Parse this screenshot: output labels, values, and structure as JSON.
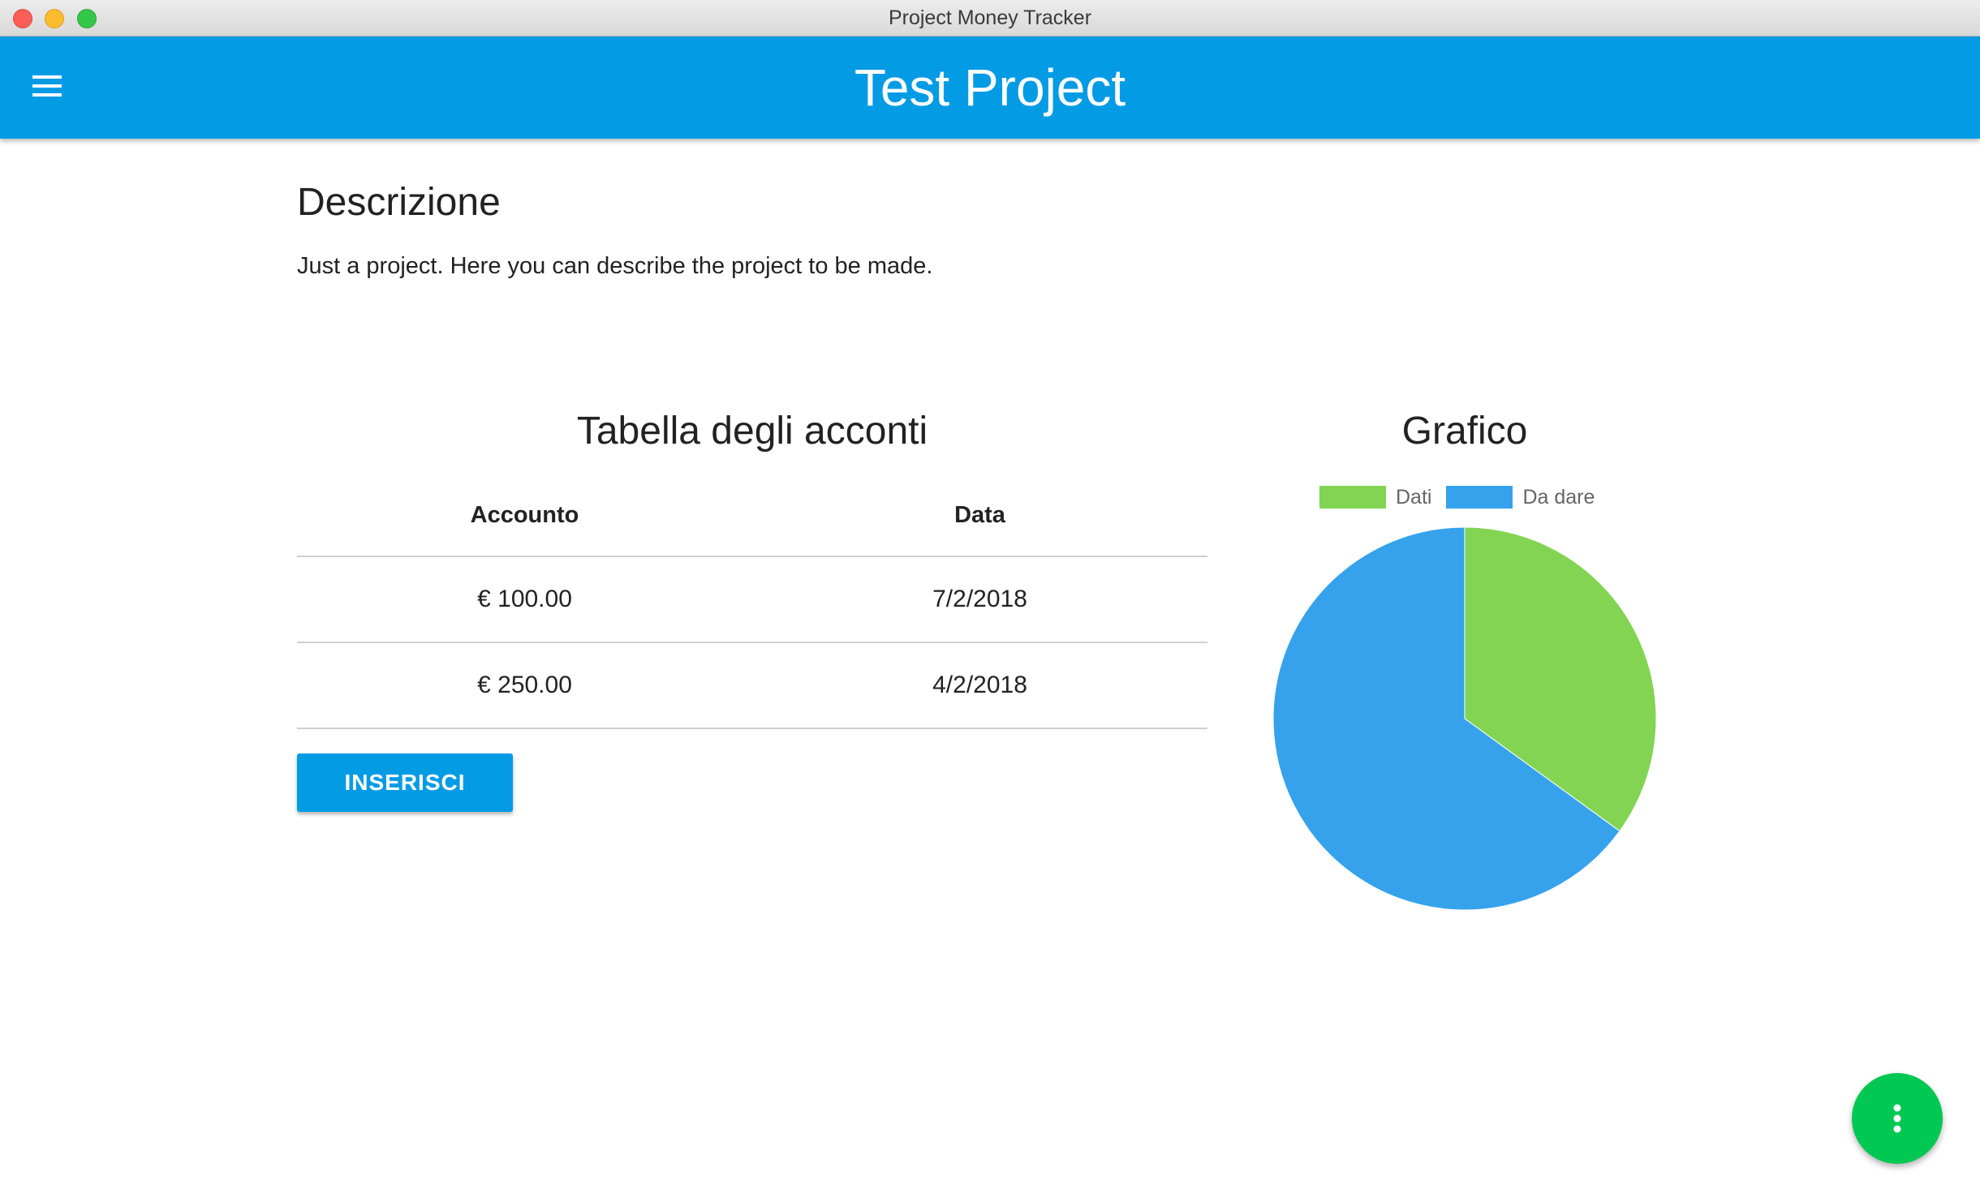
{
  "window": {
    "title": "Project Money Tracker"
  },
  "appbar": {
    "title": "Test Project",
    "menu_icon": "hamburger-menu-icon",
    "background_color": "#049be5"
  },
  "description": {
    "heading": "Descrizione",
    "text": "Just a project. Here you can describe the project to be made."
  },
  "accounts_table": {
    "title": "Tabella degli acconti",
    "columns": [
      "Accounto",
      "Data"
    ],
    "rows": [
      {
        "amount": "€ 100.00",
        "date": "7/2/2018"
      },
      {
        "amount": "€ 250.00",
        "date": "4/2/2018"
      }
    ],
    "insert_label": "INSERISCI"
  },
  "chart": {
    "title": "Grafico",
    "legend": [
      {
        "label": "Dati",
        "color": "#82d452"
      },
      {
        "label": "Da dare",
        "color": "#36a2eb"
      }
    ]
  },
  "chart_data": {
    "type": "pie",
    "title": "Grafico",
    "categories": [
      "Dati",
      "Da dare"
    ],
    "values": [
      35,
      65
    ],
    "colors": [
      "#82d452",
      "#36a2eb"
    ],
    "legend_position": "top"
  },
  "fab": {
    "icon": "more-vertical-icon",
    "color": "#00c853"
  }
}
